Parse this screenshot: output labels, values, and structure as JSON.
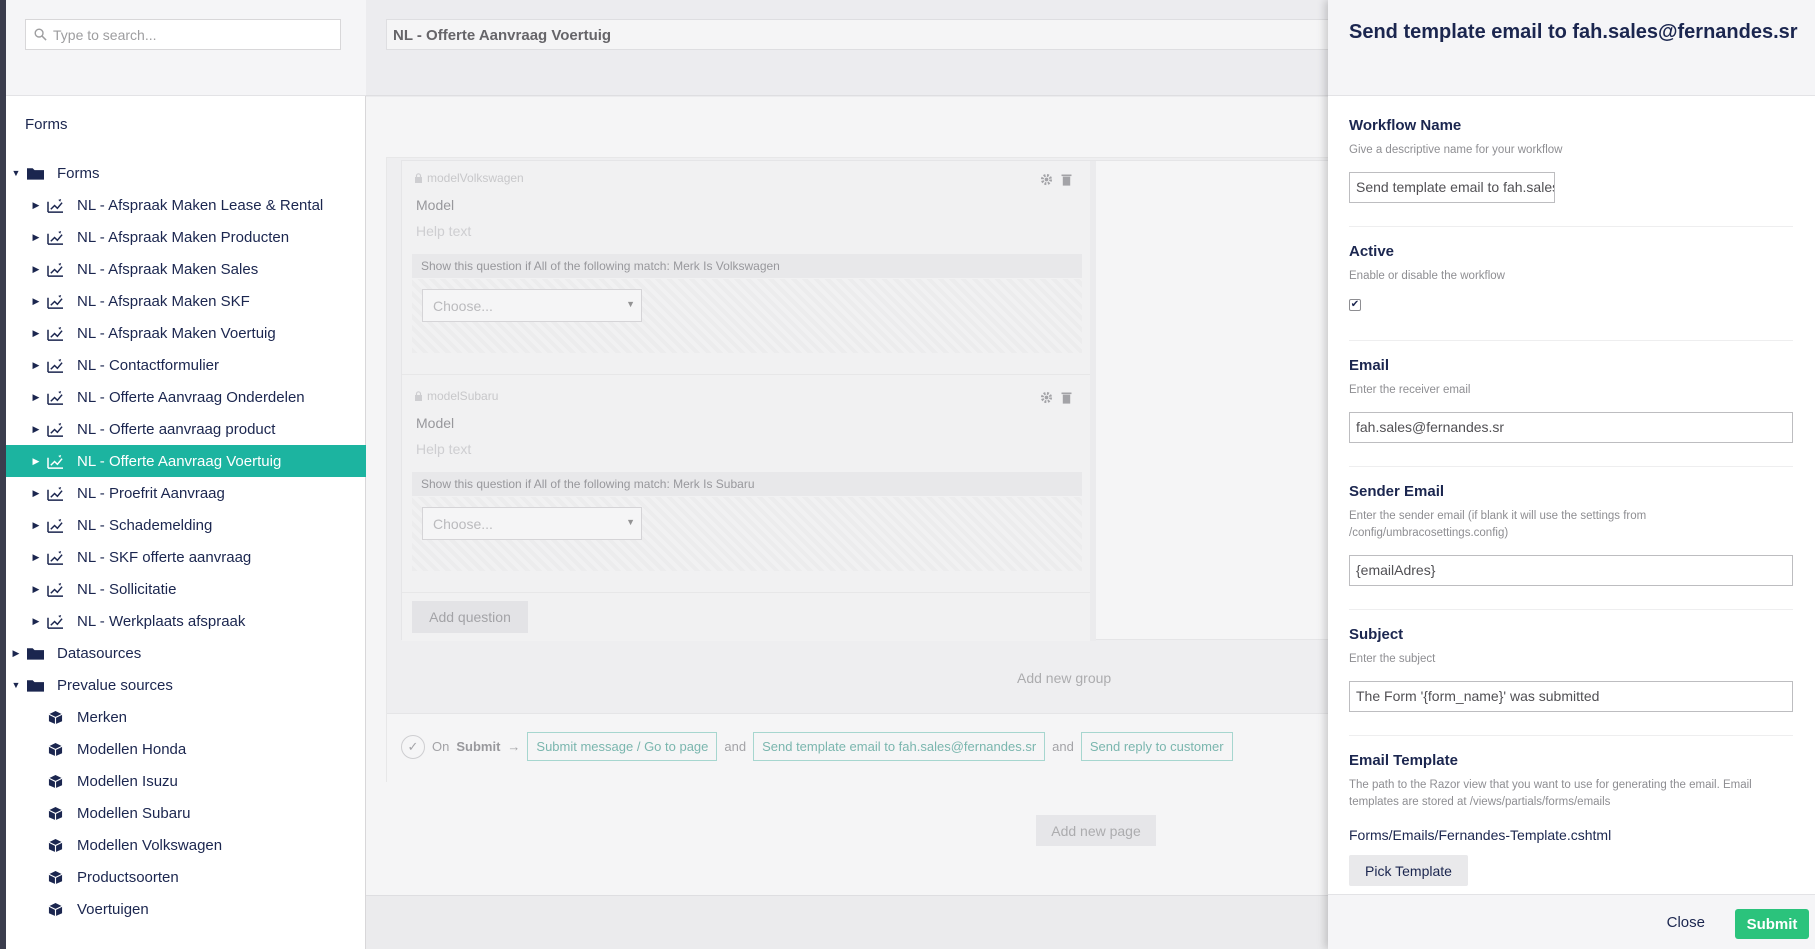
{
  "search": {
    "placeholder": "Type to search..."
  },
  "sidebar": {
    "section_title": "Forms",
    "tree": [
      {
        "label": "Forms",
        "level": 0,
        "type": "folder",
        "expanded": true
      },
      {
        "label": "NL - Afspraak Maken Lease & Rental",
        "level": 1,
        "type": "form"
      },
      {
        "label": "NL - Afspraak Maken Producten",
        "level": 1,
        "type": "form"
      },
      {
        "label": "NL - Afspraak Maken Sales",
        "level": 1,
        "type": "form"
      },
      {
        "label": "NL - Afspraak Maken SKF",
        "level": 1,
        "type": "form"
      },
      {
        "label": "NL - Afspraak Maken Voertuig",
        "level": 1,
        "type": "form"
      },
      {
        "label": "NL - Contactformulier",
        "level": 1,
        "type": "form"
      },
      {
        "label": "NL - Offerte Aanvraag Onderdelen",
        "level": 1,
        "type": "form"
      },
      {
        "label": "NL - Offerte aanvraag product",
        "level": 1,
        "type": "form"
      },
      {
        "label": "NL - Offerte Aanvraag Voertuig",
        "level": 1,
        "type": "form",
        "selected": true
      },
      {
        "label": "NL - Proefrit Aanvraag",
        "level": 1,
        "type": "form"
      },
      {
        "label": "NL - Schademelding",
        "level": 1,
        "type": "form"
      },
      {
        "label": "NL - SKF offerte aanvraag",
        "level": 1,
        "type": "form"
      },
      {
        "label": "NL - Sollicitatie",
        "level": 1,
        "type": "form"
      },
      {
        "label": "NL - Werkplaats afspraak",
        "level": 1,
        "type": "form"
      },
      {
        "label": "Datasources",
        "level": 0,
        "type": "folder",
        "expanded": false
      },
      {
        "label": "Prevalue sources",
        "level": 0,
        "type": "folder",
        "expanded": true
      },
      {
        "label": "Merken",
        "level": 1,
        "type": "prevalue"
      },
      {
        "label": "Modellen Honda",
        "level": 1,
        "type": "prevalue"
      },
      {
        "label": "Modellen Isuzu",
        "level": 1,
        "type": "prevalue"
      },
      {
        "label": "Modellen Subaru",
        "level": 1,
        "type": "prevalue"
      },
      {
        "label": "Modellen Volkswagen",
        "level": 1,
        "type": "prevalue"
      },
      {
        "label": "Productsoorten",
        "level": 1,
        "type": "prevalue"
      },
      {
        "label": "Voertuigen",
        "level": 1,
        "type": "prevalue"
      }
    ]
  },
  "editor": {
    "form_name": "NL - Offerte Aanvraag Voertuig",
    "questions": [
      {
        "alias": "modelVolkswagen",
        "label": "Model",
        "help": "Help text",
        "condition": "Show this question if All of the following match: Merk Is Volkswagen",
        "select_placeholder": "Choose..."
      },
      {
        "alias": "modelSubaru",
        "label": "Model",
        "help": "Help text",
        "condition": "Show this question if All of the following match: Merk Is Subaru",
        "select_placeholder": "Choose..."
      }
    ],
    "add_question": "Add question",
    "add_group": "Add new group",
    "submit_flow": {
      "on": "On",
      "submit": "Submit",
      "arrow": "→",
      "and": "and",
      "workflows": [
        "Submit message / Go to page",
        "Send template email to fah.sales@fernandes.sr",
        "Send reply to customer"
      ]
    },
    "add_page": "Add new page"
  },
  "panel": {
    "title": "Send template email to fah.sales@fernandes.sr",
    "workflow_name": {
      "label": "Workflow Name",
      "desc": "Give a descriptive name for your workflow",
      "value": "Send template email to fah.sales@fernandes.sr"
    },
    "active": {
      "label": "Active",
      "desc": "Enable or disable the workflow",
      "checked": true,
      "check_glyph": "✔"
    },
    "email": {
      "label": "Email",
      "desc": "Enter the receiver email",
      "value": "fah.sales@fernandes.sr"
    },
    "sender_email": {
      "label": "Sender Email",
      "desc": "Enter the sender email (if blank it will use the settings from /config/umbracosettings.config)",
      "value": "{emailAdres}"
    },
    "subject": {
      "label": "Subject",
      "desc": "Enter the subject",
      "value": "The Form '{form_name}' was submitted"
    },
    "email_template": {
      "label": "Email Template",
      "desc": "The path to the Razor view that you want to use for generating the email. Email templates are stored at /views/partials/forms/emails",
      "path": "Forms/Emails/Fernandes-Template.cshtml",
      "pick_button": "Pick Template"
    },
    "close": "Close",
    "submit": "Submit"
  },
  "colors": {
    "accent": "#1cb4a0",
    "submit": "#2bc37c",
    "text": "#1b264f"
  },
  "icons": {
    "search": "search-icon",
    "folder": "folder-icon",
    "form": "form-icon",
    "prevalue": "prevalue-icon",
    "settings": "gear-icon",
    "delete": "trash-icon",
    "lock": "lock-icon",
    "check": "check-icon"
  }
}
